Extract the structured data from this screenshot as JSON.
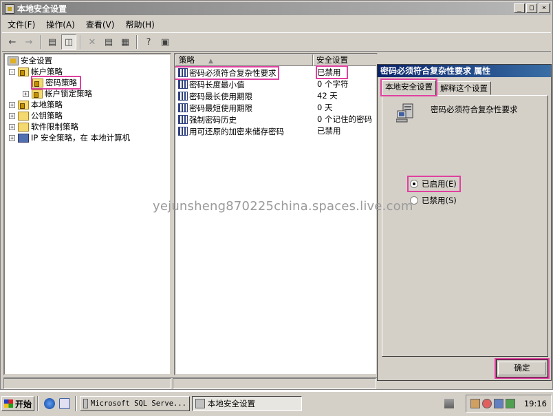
{
  "window": {
    "title": "本地安全设置",
    "buttons": [
      "_",
      "□",
      "×"
    ]
  },
  "menu": [
    "文件(F)",
    "操作(A)",
    "查看(V)",
    "帮助(H)"
  ],
  "toolbar_icons": [
    "back-icon",
    "forward-icon",
    "up-folder-icon",
    "show-hide-tree-icon",
    "delete-icon",
    "properties-icon",
    "export-list-icon",
    "help-icon",
    "console-icon"
  ],
  "tree": [
    {
      "label": "安全设置",
      "icon": "security-settings-icon",
      "expander": ""
    },
    {
      "label": "帐户策略",
      "icon": "lock-folder-icon",
      "expander": "-"
    },
    {
      "label": "密码策略",
      "icon": "lock-folder-icon",
      "expander": "",
      "selected": true
    },
    {
      "label": "帐户锁定策略",
      "icon": "lock-folder-icon",
      "expander": "+"
    },
    {
      "label": "本地策略",
      "icon": "lock-folder-icon",
      "expander": "+"
    },
    {
      "label": "公钥策略",
      "icon": "folder-icon",
      "expander": "+"
    },
    {
      "label": "软件限制策略",
      "icon": "folder-icon",
      "expander": "+"
    },
    {
      "label": "IP 安全策略，在 本地计算机",
      "icon": "ip-security-icon",
      "expander": "+"
    }
  ],
  "list": {
    "columns": [
      "策略",
      "安全设置"
    ],
    "rows": [
      {
        "policy": "密码必须符合复杂性要求",
        "setting": "已禁用"
      },
      {
        "policy": "密码长度最小值",
        "setting": "0 个字符"
      },
      {
        "policy": "密码最长使用期限",
        "setting": "42 天"
      },
      {
        "policy": "密码最短使用期限",
        "setting": "0 天"
      },
      {
        "policy": "强制密码历史",
        "setting": "0 个记住的密码"
      },
      {
        "policy": "用可还原的加密来储存密码",
        "setting": "已禁用"
      }
    ]
  },
  "dialog": {
    "title": "密码必须符合复杂性要求 属性",
    "tabs": [
      "本地安全设置",
      "解释这个设置"
    ],
    "policy_name": "密码必须符合复杂性要求",
    "options": [
      {
        "label": "已启用(E)",
        "checked": true
      },
      {
        "label": "已禁用(S)",
        "checked": false
      }
    ],
    "ok_label": "确定"
  },
  "watermark": "yejunsheng870225china.spaces.live.com",
  "taskbar": {
    "start_label": "开始",
    "tasks": [
      {
        "label": "Microsoft SQL Serve...",
        "active": false
      },
      {
        "label": "本地安全设置",
        "active": true
      }
    ],
    "clock": "19:16"
  },
  "colors": {
    "highlight": "#e040a0",
    "dialog_title": "#0a246a",
    "face": "#d4d0c8"
  }
}
